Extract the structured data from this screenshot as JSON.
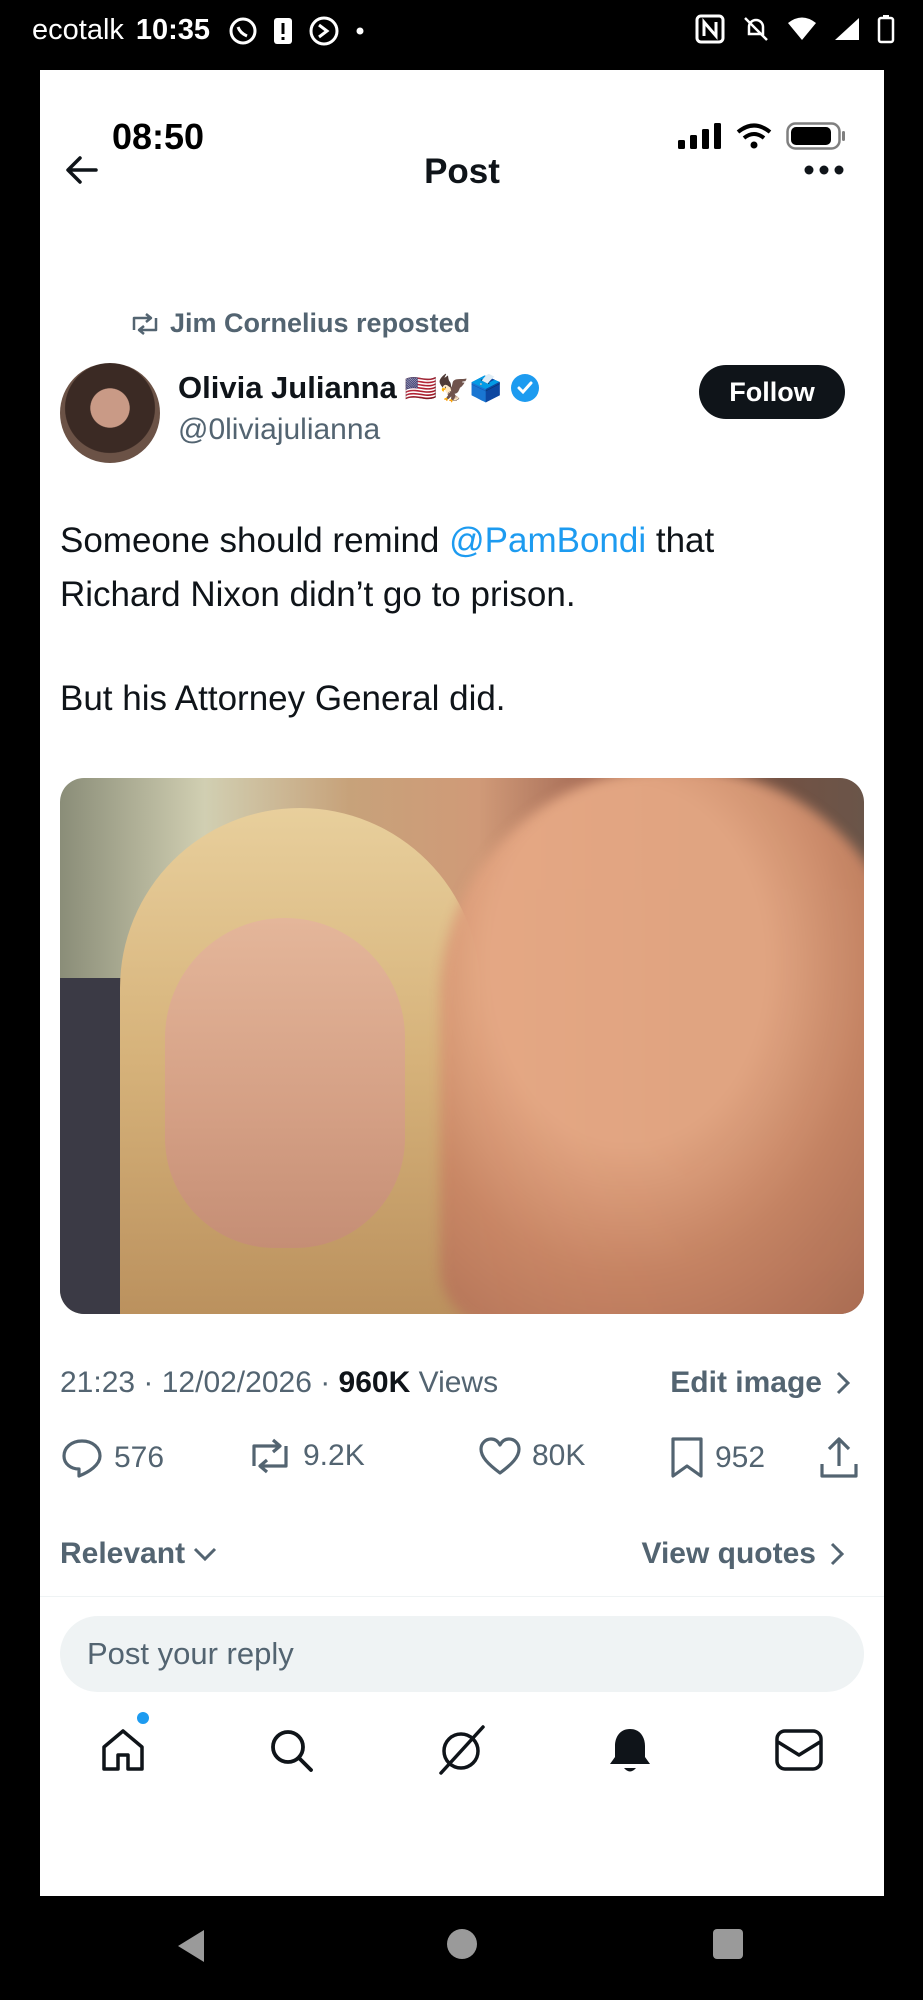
{
  "system_status": {
    "carrier": "ecotalk",
    "time": "10:35"
  },
  "ios_status": {
    "time": "08:50"
  },
  "header": {
    "title": "Post"
  },
  "post": {
    "repost_label": "Jim Cornelius reposted",
    "author_name": "Olivia Julianna",
    "author_emojis": "🇺🇸🦅🗳️",
    "handle": "@0liviajulianna",
    "follow_label": "Follow",
    "text_before_mention": "Someone should remind ",
    "mention": "@PamBondi",
    "text_after_mention": " that",
    "text_line2": "Richard Nixon didn’t go to prison.",
    "text_line3": "But his Attorney General did.",
    "timestamp": "21:23 · 12/02/2026 · ",
    "views_count": "960K",
    "views_label": " Views",
    "edit_image_label": "Edit image"
  },
  "actions": {
    "replies": "576",
    "reposts": "9.2K",
    "likes": "80K",
    "bookmarks": "952"
  },
  "sort": {
    "relevant_label": "Relevant",
    "view_quotes_label": "View quotes"
  },
  "reply": {
    "placeholder": "Post your reply"
  },
  "colors": {
    "accent": "#1d9bf0",
    "text": "#0f1419",
    "muted": "#536471"
  },
  "icons": [
    "back-arrow-icon",
    "more-icon",
    "repost-icon",
    "verified-icon",
    "reply-icon",
    "like-icon",
    "bookmark-icon",
    "share-icon",
    "home-icon",
    "search-icon",
    "grok-icon",
    "bell-icon",
    "mail-icon"
  ]
}
